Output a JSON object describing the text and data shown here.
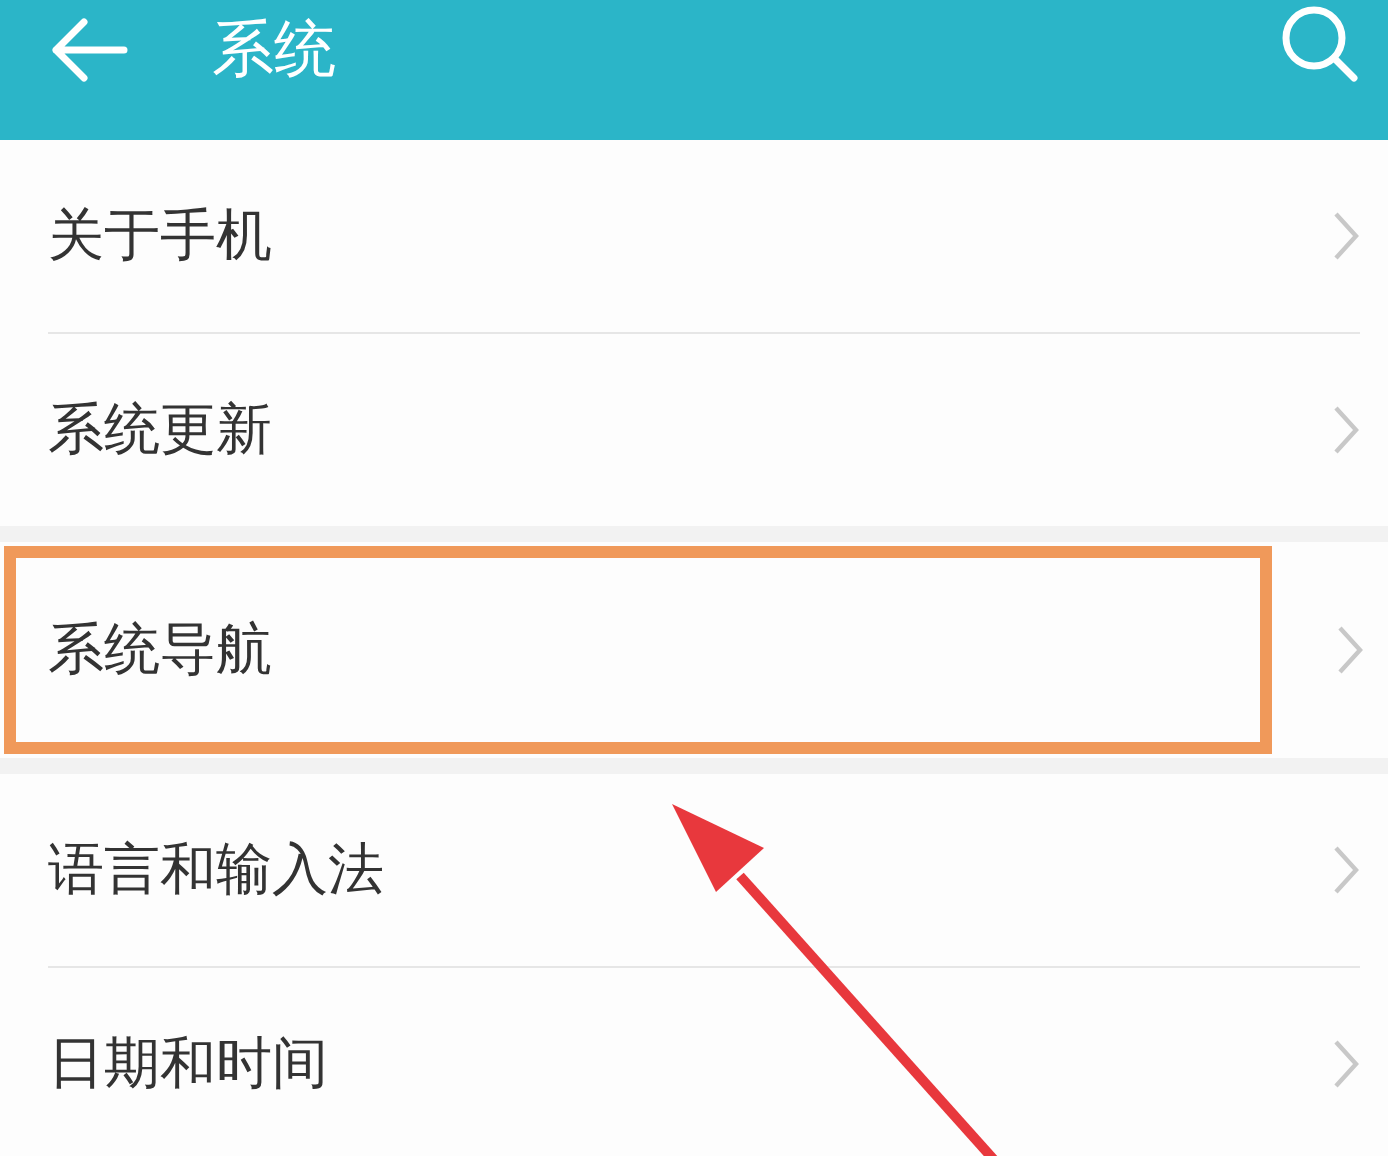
{
  "header": {
    "title": "系统"
  },
  "groups": [
    {
      "items": [
        {
          "label": "关于手机",
          "highlighted": false
        },
        {
          "label": "系统更新",
          "highlighted": false
        }
      ]
    },
    {
      "items": [
        {
          "label": "系统导航",
          "highlighted": true
        }
      ]
    },
    {
      "items": [
        {
          "label": "语言和输入法",
          "highlighted": false
        },
        {
          "label": "日期和时间",
          "highlighted": false
        }
      ]
    }
  ]
}
